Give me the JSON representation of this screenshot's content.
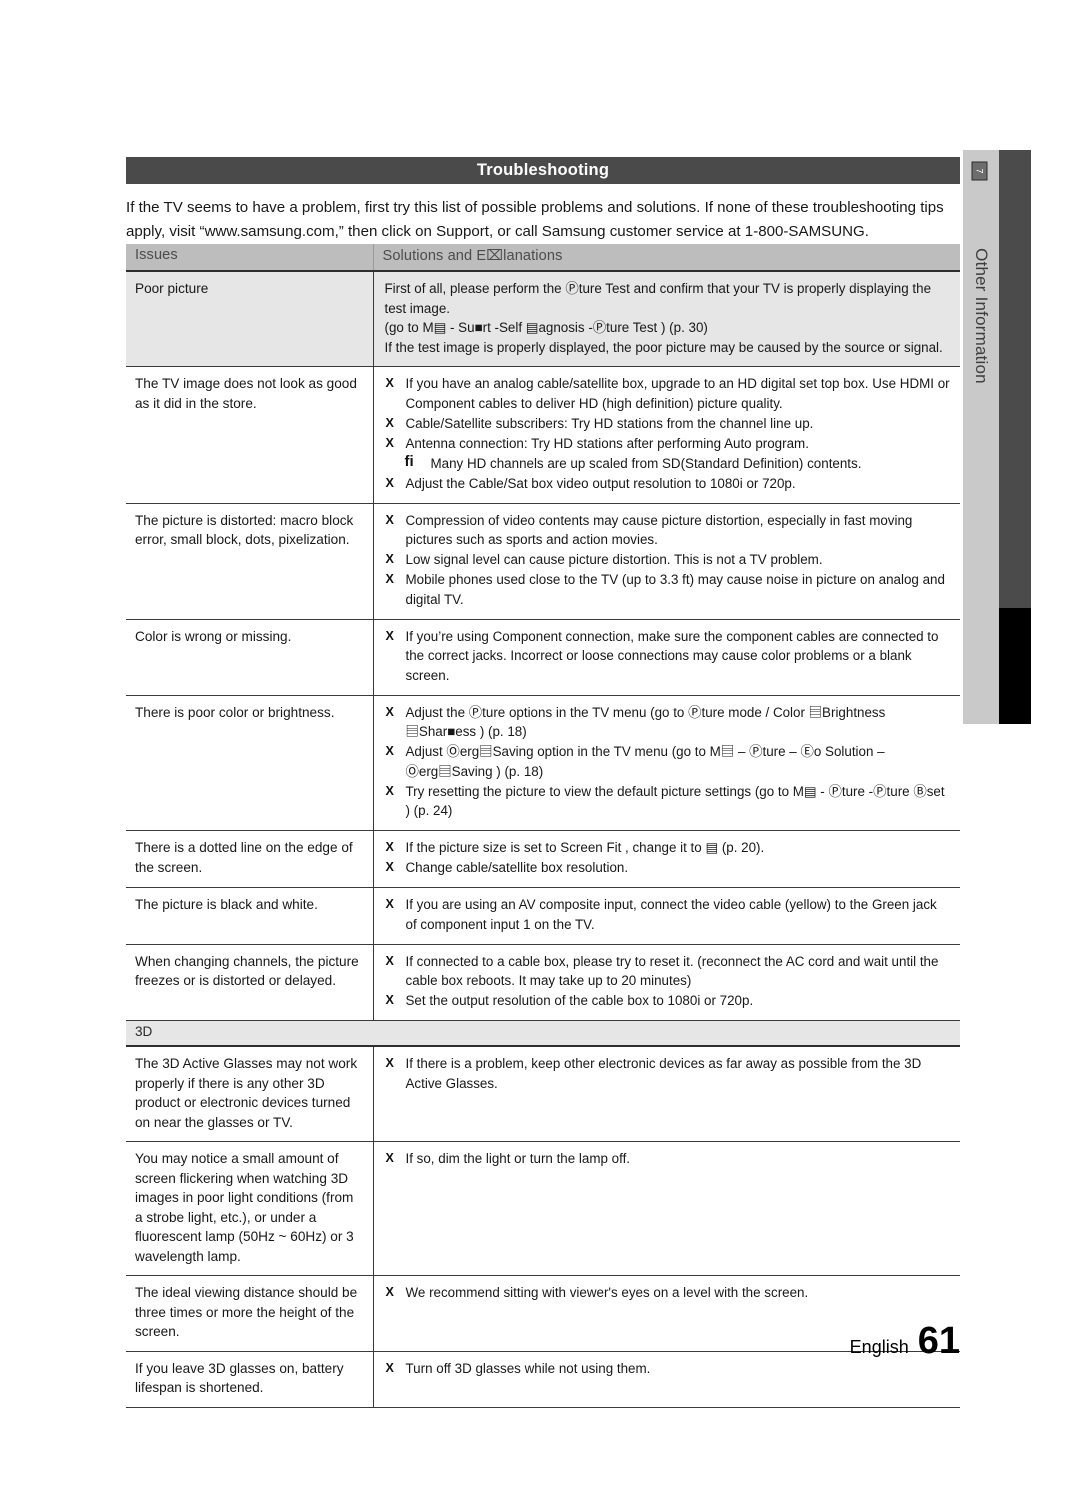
{
  "sidebar": {
    "tab_label": "Other Information",
    "icon_name": "boxed-arrow-icon",
    "icon_glyph": "7"
  },
  "header": {
    "title": "Troubleshooting"
  },
  "intro": {
    "paragraph": "If the TV seems to have a problem, first try this list of possible problems and solutions. If none of these troubleshooting tips apply, visit “www.samsung.com,” then click on Support, or call Samsung customer service at 1-800-SAMSUNG."
  },
  "table": {
    "columns": {
      "issues": "Issues",
      "solutions": "Solutions and E⌧lanations"
    },
    "rows": [
      {
        "issue": "Poor picture",
        "shaded": true,
        "lines": [
          "First of all, please perform the Ⓟture Test   and confirm that your TV is properly displaying the test image.",
          "(go to M▤    - Su■rt -Self ▤agnosis -Ⓟture Test            ) (p. 30)",
          "If the test image is properly displayed, the poor picture may be caused by the source or signal."
        ]
      },
      {
        "issue": "The TV image does not look as good as it did in the store.",
        "shaded": false,
        "bullets": [
          {
            "mark": "X",
            "text": "If you have an analog cable/satellite box, upgrade to an HD digital set top box. Use HDMI or Component cables to deliver HD (high definition) picture quality."
          },
          {
            "mark": "X",
            "text": "Cable/Satellite subscribers: Try HD stations from the channel line up."
          },
          {
            "mark": "X",
            "text": "Antenna connection: Try HD stations after performing Auto program."
          },
          {
            "mark": "fi",
            "note": true,
            "text": "Many HD channels are up scaled from SD(Standard Definition) contents."
          },
          {
            "mark": "X",
            "text": "Adjust the Cable/Sat box video output resolution to 1080i or 720p."
          }
        ]
      },
      {
        "issue": "The picture is distorted: macro block error, small block, dots, pixelization.",
        "shaded": false,
        "bullets": [
          {
            "mark": "X",
            "text": "Compression of video contents may cause picture distortion, especially in fast moving pictures such as sports and action movies."
          },
          {
            "mark": "X",
            "text": "Low signal level can cause picture distortion. This is not a TV problem."
          },
          {
            "mark": "X",
            "text": "Mobile phones used close to the TV (up to 3.3 ft) may cause noise in picture on analog and digital TV."
          }
        ]
      },
      {
        "issue": "Color is wrong or missing.",
        "shaded": false,
        "bullets": [
          {
            "mark": "X",
            "text": "If you’re using Component connection, make sure the component cables are connected to the correct jacks. Incorrect or loose connections may cause color problems or a blank screen."
          }
        ]
      },
      {
        "issue": "There is poor color or brightness.",
        "shaded": false,
        "bullets": [
          {
            "mark": "X",
            "text": "Adjust the Ⓟture    options in the TV menu (go to Ⓟture    mode / Color ▤Brightness ▤Shar■ess        ) (p. 18)"
          },
          {
            "mark": "X",
            "text": "Adjust Ⓞerg▤Saving      option in the TV menu (go to M▤     – Ⓟture    – Ⓔo Solution     – Ⓞerg▤Saving     ) (p. 18)"
          },
          {
            "mark": "X",
            "text": "Try resetting the picture to view the default picture settings (go to M▤     - Ⓟture -Ⓟture Ⓑset          ) (p. 24)"
          }
        ]
      },
      {
        "issue": "There is a dotted line on the edge of the screen.",
        "shaded": false,
        "bullets": [
          {
            "mark": "X",
            "text": "If the picture size is set to Screen Fit , change it to ▤    (p. 20)."
          },
          {
            "mark": "X",
            "text": "Change cable/satellite box resolution."
          }
        ]
      },
      {
        "issue": "The picture is black and white.",
        "shaded": false,
        "bullets": [
          {
            "mark": "X",
            "text": "If you are using an AV composite input, connect the video cable (yellow) to the Green jack of component input 1 on the TV."
          }
        ]
      },
      {
        "issue": "When changing channels, the picture freezes or is distorted or delayed.",
        "shaded": false,
        "bullets": [
          {
            "mark": "X",
            "text": "If connected to a cable box, please try to reset it. (reconnect the AC cord and wait until the cable box reboots. It may take up to 20 minutes)"
          },
          {
            "mark": "X",
            "text": "Set the output resolution of the cable box to 1080i or 720p."
          }
        ]
      }
    ],
    "section_3d": {
      "label": "3D",
      "rows": [
        {
          "issue": "The 3D Active Glasses may not work properly if there is any other 3D product or electronic devices turned on near the glasses or TV.",
          "bullets": [
            {
              "mark": "X",
              "text": "If there is a problem, keep other electronic devices as far away as possible from the 3D Active Glasses."
            }
          ]
        },
        {
          "issue": "You may notice a small amount of screen flickering when watching 3D images in poor light conditions (from a strobe light, etc.), or under a fluorescent lamp (50Hz ~ 60Hz) or 3 wavelength lamp.",
          "bullets": [
            {
              "mark": "X",
              "text": "If so, dim the light or turn the lamp off."
            }
          ]
        },
        {
          "issue": "The ideal viewing distance should be three times or more the height of the screen.",
          "bullets": [
            {
              "mark": "X",
              "text": "We recommend sitting with viewer's eyes on a level with the screen."
            }
          ]
        },
        {
          "issue": "If you leave 3D glasses on, battery lifespan is shortened.",
          "bullets": [
            {
              "mark": "X",
              "text": "Turn off 3D glasses while not using them."
            }
          ]
        }
      ]
    }
  },
  "footer": {
    "language": "English",
    "page_number": "61"
  }
}
